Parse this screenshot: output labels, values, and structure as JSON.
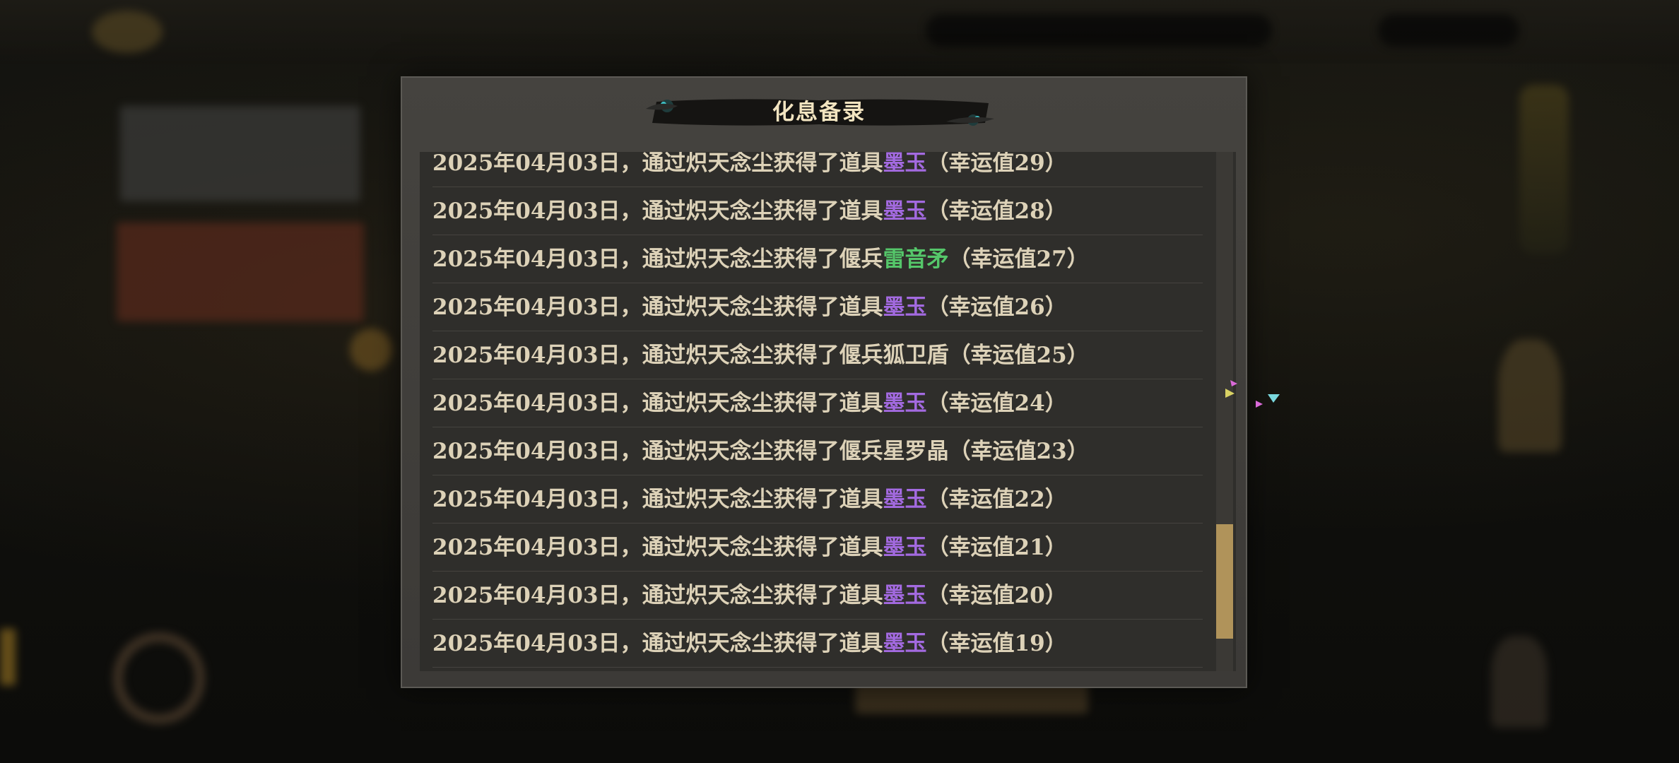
{
  "dialog": {
    "title": "化息备录"
  },
  "records": [
    {
      "date": "2025年04月03日，",
      "verb": "通过炽天念尘获得了",
      "kind": "道具",
      "item": "墨玉",
      "item_color": "purple",
      "luck": "（幸运值29）"
    },
    {
      "date": "2025年04月03日，",
      "verb": "通过炽天念尘获得了",
      "kind": "道具",
      "item": "墨玉",
      "item_color": "purple",
      "luck": "（幸运值28）"
    },
    {
      "date": "2025年04月03日，",
      "verb": "通过炽天念尘获得了",
      "kind": "偃兵",
      "item": "雷音矛",
      "item_color": "green",
      "luck": "（幸运值27）"
    },
    {
      "date": "2025年04月03日，",
      "verb": "通过炽天念尘获得了",
      "kind": "道具",
      "item": "墨玉",
      "item_color": "purple",
      "luck": "（幸运值26）"
    },
    {
      "date": "2025年04月03日，",
      "verb": "通过炽天念尘获得了",
      "kind": "偃兵",
      "item": "狐卫盾",
      "item_color": "plain",
      "luck": "（幸运值25）"
    },
    {
      "date": "2025年04月03日，",
      "verb": "通过炽天念尘获得了",
      "kind": "道具",
      "item": "墨玉",
      "item_color": "purple",
      "luck": "（幸运值24）"
    },
    {
      "date": "2025年04月03日，",
      "verb": "通过炽天念尘获得了",
      "kind": "偃兵",
      "item": "星罗晶",
      "item_color": "plain",
      "luck": "（幸运值23）"
    },
    {
      "date": "2025年04月03日，",
      "verb": "通过炽天念尘获得了",
      "kind": "道具",
      "item": "墨玉",
      "item_color": "purple",
      "luck": "（幸运值22）"
    },
    {
      "date": "2025年04月03日，",
      "verb": "通过炽天念尘获得了",
      "kind": "道具",
      "item": "墨玉",
      "item_color": "purple",
      "luck": "（幸运值21）"
    },
    {
      "date": "2025年04月03日，",
      "verb": "通过炽天念尘获得了",
      "kind": "道具",
      "item": "墨玉",
      "item_color": "purple",
      "luck": "（幸运值20）"
    },
    {
      "date": "2025年04月03日，",
      "verb": "通过炽天念尘获得了",
      "kind": "道具",
      "item": "墨玉",
      "item_color": "purple",
      "luck": "（幸运值19）"
    }
  ],
  "colors": {
    "text": "#ddd2b8",
    "purple_item": "#a36ae0",
    "green_item": "#55c76a",
    "scroll_thumb": "#b0935a",
    "title": "#f2e4c0"
  },
  "scroll": {
    "position_fraction": 0.92
  }
}
